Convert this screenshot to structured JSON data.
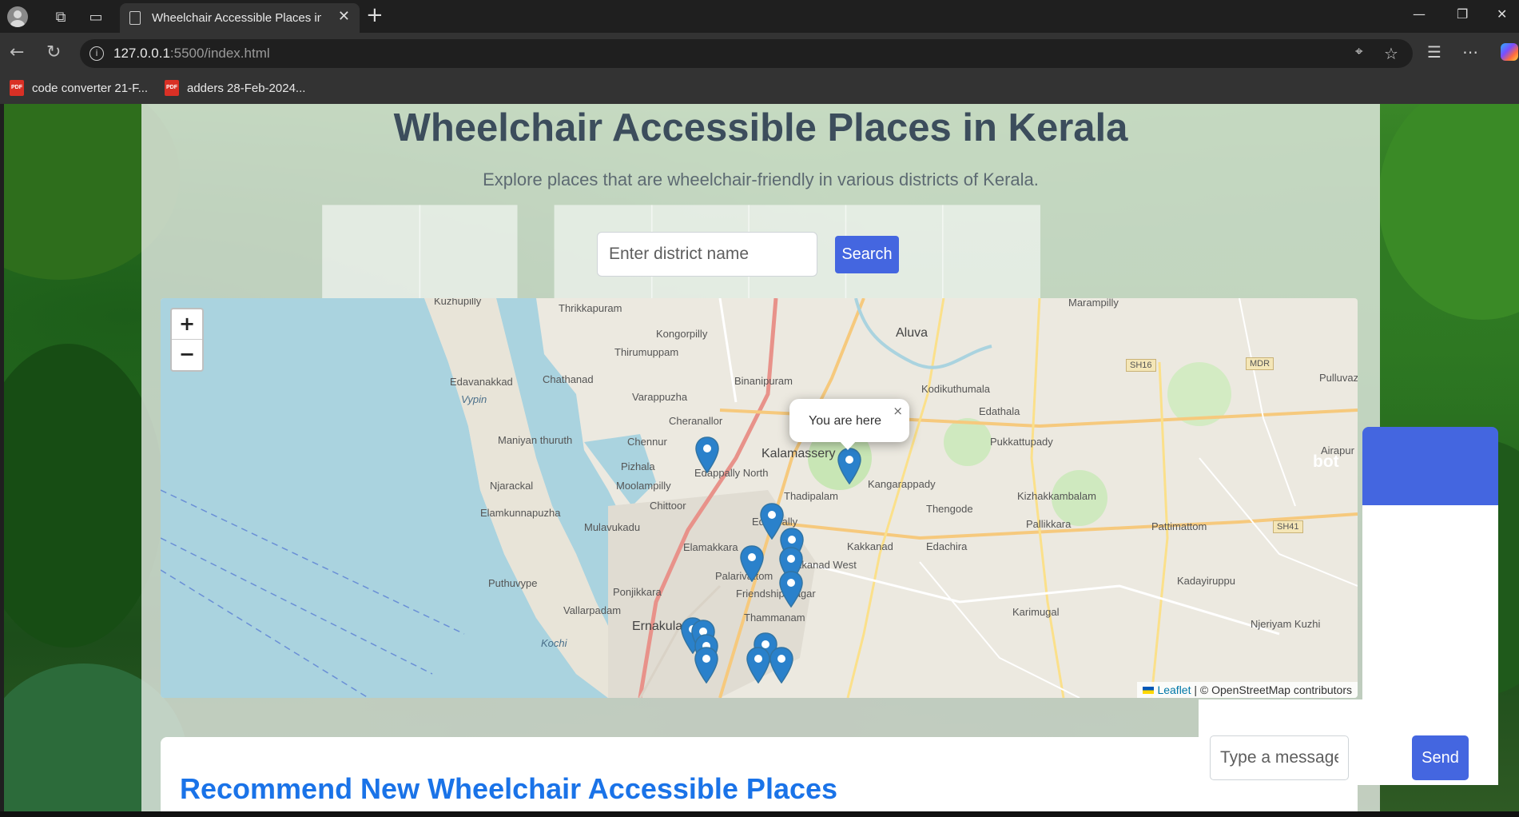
{
  "browser": {
    "tab_title": "Wheelchair Accessible Places in Ke",
    "url_host": "127.0.0.1",
    "url_path": ":5500/index.html",
    "bookmarks": [
      {
        "label": "code converter 21-F..."
      },
      {
        "label": "adders 28-Feb-2024..."
      }
    ]
  },
  "page": {
    "title": "Wheelchair Accessible Places in Kerala",
    "subtitle": "Explore places that are wheelchair-friendly in various districts of Kerala.",
    "search": {
      "placeholder": "Enter district name",
      "button_label": "Search"
    }
  },
  "map": {
    "zoom_in_label": "+",
    "zoom_out_label": "−",
    "popup_text": "You are here",
    "popup_close": "×",
    "attribution_link": "Leaflet",
    "attribution_text": "| © OpenStreetMap contributors",
    "places": [
      "Kuzhupilly",
      "Thrikkapuram",
      "Marampilly",
      "Kongorpilly",
      "Aluva",
      "Thirumuppam",
      "Edavanakkad",
      "Chathanad",
      "Vypin",
      "Binanipuram",
      "Kodikuthumala",
      "Varappuzha",
      "Edathala",
      "Cheranallor",
      "Maniyan thuruth",
      "Chennur",
      "Kalamassery",
      "Pukkattupady",
      "Pizhala",
      "Edappally North",
      "Njarackal",
      "Moolampilly",
      "Kangarappady",
      "Chittoor",
      "Thadipalam",
      "Kizhakkambalam",
      "Elamkunnapuzha",
      "Thengode",
      "Pallikkara",
      "Pattimattom",
      "Mulavukadu",
      "Edappally",
      "Elamakkara",
      "Kakkanad",
      "Edachira",
      "Kakkanad West",
      "Puthuvype",
      "Palarivattom",
      "Kadayiruppu",
      "Ponjikkara",
      "Friendship Nagar",
      "Vallarpadam",
      "Karimugal",
      "Thammanam",
      "Ernakulam",
      "Njeriyam Kuzhi",
      "Kochi",
      "Airapur",
      "Pulluvazhi",
      "Kalamassery"
    ],
    "shields": [
      "SH16",
      "MDR",
      "SH41"
    ]
  },
  "recommend": {
    "title": "Recommend New Wheelchair Accessible Places"
  },
  "chatbot": {
    "title_fragment": "bot",
    "input_placeholder": "Type a message...",
    "send_label": "Send"
  }
}
